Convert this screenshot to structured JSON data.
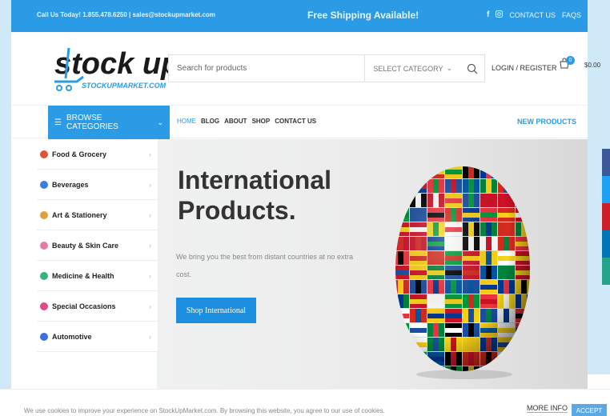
{
  "topbar": {
    "contact": "Call Us Today! 1.855.478.6250 | sales@stockupmarket.com",
    "shipping": "Free Shipping Available!",
    "contact_us": "CONTACT US",
    "faqs": "FAQS"
  },
  "logo": {
    "main": "stock up",
    "sub": "STOCKUPMARKET.COM"
  },
  "search": {
    "placeholder": "Search for products",
    "category": "SELECT CATEGORY"
  },
  "account": {
    "login": "LOGIN / REGISTER",
    "cart_count": "0",
    "cart_total": "$0.00"
  },
  "nav": {
    "browse": "BROWSE CATEGORIES",
    "links": [
      "HOME",
      "BLOG",
      "ABOUT",
      "SHOP",
      "CONTACT US"
    ],
    "new_products": "NEW PRODUCTS"
  },
  "sidebar": {
    "items": [
      {
        "label": "Food & Grocery",
        "color": "#e0533a"
      },
      {
        "label": "Beverages",
        "color": "#3a7fe0"
      },
      {
        "label": "Art & Stationery",
        "color": "#e0a13a"
      },
      {
        "label": "Beauty & Skin Care",
        "color": "#e87aa8"
      },
      {
        "label": "Medicine & Health",
        "color": "#3ab07a"
      },
      {
        "label": "Special Occasions",
        "color": "#e04a8a"
      },
      {
        "label": "Automotive",
        "color": "#3a6fe0"
      }
    ]
  },
  "hero": {
    "title_line1": "International",
    "title_line2": "Products.",
    "subtitle": "We bring you the best from distant countries at no extra cost.",
    "button": "Shop International"
  },
  "cookie": {
    "text": "We use cookies to improve your experience on StockUpMarket.com. By browsing this website, you agree to our use of cookies.",
    "more_info": "MORE INFO",
    "accept": "ACCEPT"
  },
  "colors": {
    "accent": "#2b9be6",
    "social": [
      "#3b5998",
      "#1da1f2",
      "#cb2027",
      "#0077b5",
      "#25a38a"
    ]
  }
}
